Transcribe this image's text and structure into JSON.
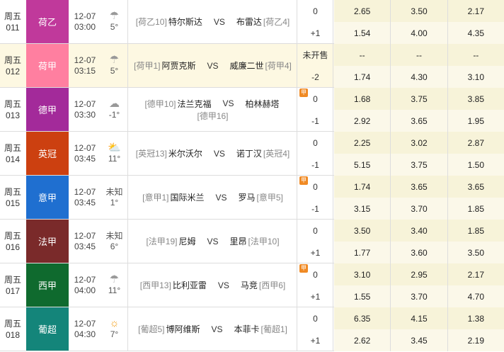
{
  "rows": [
    {
      "day": "周五",
      "num": "011",
      "league": "荷乙",
      "color": "#c0399b",
      "date": "12-07",
      "time": "03:00",
      "weather": "cloud-rain-icon",
      "temp": "5°",
      "wx_text": "",
      "home_rank": "[荷乙10]",
      "home": "特尔斯达",
      "away": "布雷达",
      "away_rank": "[荷乙4]",
      "home_rank2": "",
      "hcp_top": "0",
      "hcp_bot": "+1",
      "badge": false,
      "highlight": false,
      "odds_top": [
        "2.65",
        "3.50",
        "2.17"
      ],
      "odds_bot": [
        "1.54",
        "4.00",
        "4.35"
      ]
    },
    {
      "day": "周五",
      "num": "012",
      "league": "荷甲",
      "color": "#ff7fa0",
      "date": "12-07",
      "time": "03:15",
      "weather": "cloud-rain-icon",
      "temp": "5°",
      "wx_text": "",
      "home_rank": "[荷甲1]",
      "home": "阿贾克斯",
      "away": "威廉二世",
      "away_rank": "[荷甲4]",
      "home_rank2": "",
      "hcp_top": "未开售",
      "hcp_bot": "-2",
      "badge": false,
      "highlight": true,
      "odds_top": [
        "--",
        "--",
        "--"
      ],
      "odds_bot": [
        "1.74",
        "4.30",
        "3.10"
      ]
    },
    {
      "day": "周五",
      "num": "013",
      "league": "德甲",
      "color": "#a32a9a",
      "date": "12-07",
      "time": "03:30",
      "weather": "cloud-icon",
      "temp": "-1°",
      "wx_text": "",
      "home_rank": "[德甲10]",
      "home": "法兰克福",
      "away": "柏林赫塔",
      "away_rank": "",
      "home_rank2": "[德甲16]",
      "hcp_top": "0",
      "hcp_bot": "-1",
      "badge": true,
      "highlight": false,
      "odds_top": [
        "1.68",
        "3.75",
        "3.85"
      ],
      "odds_bot": [
        "2.92",
        "3.65",
        "1.95"
      ]
    },
    {
      "day": "周五",
      "num": "014",
      "league": "英冠",
      "color": "#cc4010",
      "date": "12-07",
      "time": "03:45",
      "weather": "sun-cloud-icon",
      "temp": "11°",
      "wx_text": "",
      "home_rank": "[英冠13]",
      "home": "米尔沃尔",
      "away": "诺丁汉",
      "away_rank": "[英冠4]",
      "home_rank2": "",
      "hcp_top": "0",
      "hcp_bot": "-1",
      "badge": false,
      "highlight": false,
      "odds_top": [
        "2.25",
        "3.02",
        "2.87"
      ],
      "odds_bot": [
        "5.15",
        "3.75",
        "1.50"
      ]
    },
    {
      "day": "周五",
      "num": "015",
      "league": "意甲",
      "color": "#1f6fd0",
      "date": "12-07",
      "time": "03:45",
      "weather": "",
      "temp": "1°",
      "wx_text": "未知",
      "home_rank": "[意甲1]",
      "home": "国际米兰",
      "away": "罗马",
      "away_rank": "[意甲5]",
      "home_rank2": "",
      "hcp_top": "0",
      "hcp_bot": "-1",
      "badge": true,
      "highlight": false,
      "odds_top": [
        "1.74",
        "3.65",
        "3.65"
      ],
      "odds_bot": [
        "3.15",
        "3.70",
        "1.85"
      ]
    },
    {
      "day": "周五",
      "num": "016",
      "league": "法甲",
      "color": "#7a2a2a",
      "date": "12-07",
      "time": "03:45",
      "weather": "",
      "temp": "6°",
      "wx_text": "未知",
      "home_rank": "[法甲19]",
      "home": "尼姆",
      "away": "里昂",
      "away_rank": "[法甲10]",
      "home_rank2": "",
      "hcp_top": "0",
      "hcp_bot": "+1",
      "badge": false,
      "highlight": false,
      "odds_top": [
        "3.50",
        "3.40",
        "1.85"
      ],
      "odds_bot": [
        "1.77",
        "3.60",
        "3.50"
      ]
    },
    {
      "day": "周五",
      "num": "017",
      "league": "西甲",
      "color": "#0f6a2e",
      "date": "12-07",
      "time": "04:00",
      "weather": "cloud-rain-icon",
      "temp": "11°",
      "wx_text": "",
      "home_rank": "[西甲13]",
      "home": "比利亚雷",
      "away": "马竞",
      "away_rank": "[西甲6]",
      "home_rank2": "",
      "hcp_top": "0",
      "hcp_bot": "+1",
      "badge": true,
      "highlight": false,
      "odds_top": [
        "3.10",
        "2.95",
        "2.17"
      ],
      "odds_bot": [
        "1.55",
        "3.70",
        "4.70"
      ]
    },
    {
      "day": "周五",
      "num": "018",
      "league": "葡超",
      "color": "#14857a",
      "date": "12-07",
      "time": "04:30",
      "weather": "sun-icon",
      "temp": "7°",
      "wx_text": "",
      "home_rank": "[葡超5]",
      "home": "博阿维斯",
      "away": "本菲卡",
      "away_rank": "[葡超1]",
      "home_rank2": "",
      "hcp_top": "0",
      "hcp_bot": "+1",
      "badge": false,
      "highlight": false,
      "odds_top": [
        "6.35",
        "4.15",
        "1.38"
      ],
      "odds_bot": [
        "2.62",
        "3.45",
        "2.19"
      ]
    }
  ],
  "badge_label": "甲",
  "vs_label": "VS"
}
